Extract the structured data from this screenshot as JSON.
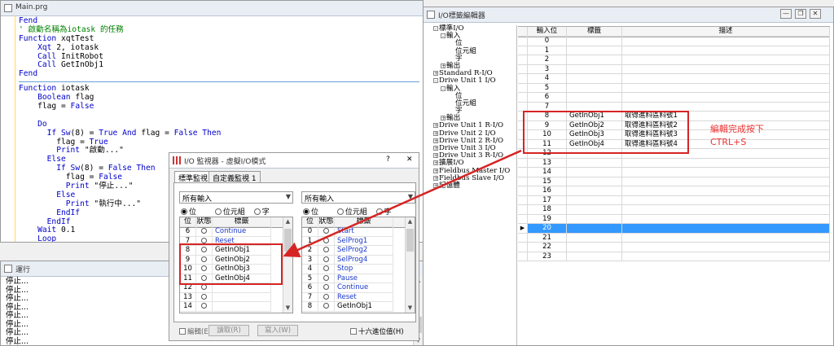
{
  "editor": {
    "title": "Main.prg",
    "lines": [
      [
        {
          "t": "Fend",
          "c": "kw"
        }
      ],
      [
        {
          "t": "' 啟動名稱為iotask 的任務",
          "c": "cm"
        }
      ],
      [
        {
          "t": "Function ",
          "c": "kw"
        },
        {
          "t": "xqtTest",
          "c": ""
        }
      ],
      [
        {
          "t": "    Xqt ",
          "c": "kw"
        },
        {
          "t": "2, iotask",
          "c": ""
        }
      ],
      [
        {
          "t": "    Call ",
          "c": "kw"
        },
        {
          "t": "InitRobot",
          "c": ""
        }
      ],
      [
        {
          "t": "    Call ",
          "c": "kw"
        },
        {
          "t": "GetInObj1",
          "c": ""
        }
      ],
      [
        {
          "t": "Fend",
          "c": "kw"
        }
      ],
      "SEP",
      [
        {
          "t": "Function ",
          "c": "kw"
        },
        {
          "t": "iotask",
          "c": ""
        }
      ],
      [
        {
          "t": "    Boolean ",
          "c": "kw"
        },
        {
          "t": "flag",
          "c": ""
        }
      ],
      [
        {
          "t": "    flag = ",
          "c": ""
        },
        {
          "t": "False",
          "c": "kw"
        }
      ],
      [
        {
          "t": "",
          "c": ""
        }
      ],
      [
        {
          "t": "    Do",
          "c": "kw"
        }
      ],
      [
        {
          "t": "      If ",
          "c": "kw"
        },
        {
          "t": "Sw",
          "c": "kw"
        },
        {
          "t": "(8) = ",
          "c": ""
        },
        {
          "t": "True ",
          "c": "kw"
        },
        {
          "t": "And ",
          "c": "kw"
        },
        {
          "t": "flag = ",
          "c": ""
        },
        {
          "t": "False ",
          "c": "kw"
        },
        {
          "t": "Then",
          "c": "kw"
        }
      ],
      [
        {
          "t": "        flag = ",
          "c": ""
        },
        {
          "t": "True",
          "c": "kw"
        }
      ],
      [
        {
          "t": "        Print ",
          "c": "kw"
        },
        {
          "t": "\"啟動...\"",
          "c": ""
        }
      ],
      [
        {
          "t": "      Else",
          "c": "kw"
        }
      ],
      [
        {
          "t": "        If ",
          "c": "kw"
        },
        {
          "t": "Sw",
          "c": "kw"
        },
        {
          "t": "(8) = ",
          "c": ""
        },
        {
          "t": "False ",
          "c": "kw"
        },
        {
          "t": "Then",
          "c": "kw"
        }
      ],
      [
        {
          "t": "          flag = ",
          "c": ""
        },
        {
          "t": "False",
          "c": "kw"
        }
      ],
      [
        {
          "t": "          Print ",
          "c": "kw"
        },
        {
          "t": "\"停止...\"",
          "c": ""
        }
      ],
      [
        {
          "t": "        Else",
          "c": "kw"
        }
      ],
      [
        {
          "t": "          Print ",
          "c": "kw"
        },
        {
          "t": "\"執行中...\"",
          "c": ""
        }
      ],
      [
        {
          "t": "        EndIf",
          "c": "kw"
        }
      ],
      [
        {
          "t": "      EndIf",
          "c": "kw"
        }
      ],
      [
        {
          "t": "    Wait ",
          "c": "kw"
        },
        {
          "t": "0.1",
          "c": ""
        }
      ],
      [
        {
          "t": "    Loop",
          "c": "kw"
        }
      ]
    ]
  },
  "output": {
    "title": "運行",
    "lines": [
      "停止...",
      "停止...",
      "停止...",
      "停止...",
      "停止...",
      "停止...",
      "停止...",
      "停止...",
      "停止...",
      "停止..."
    ]
  },
  "monitor": {
    "title": "I/O 監視器 - 虛擬I/O模式",
    "help": "?",
    "close": "✕",
    "tabs": [
      "標準監視",
      "自定義監視 1"
    ],
    "left": {
      "combo": "所有輸入",
      "radios": [
        "位",
        "位元組",
        "字"
      ],
      "headers": [
        "位",
        "狀態",
        "標籤"
      ],
      "rows": [
        {
          "n": "6",
          "l": "Continue",
          "b": true
        },
        {
          "n": "7",
          "l": "Reset",
          "b": true
        },
        {
          "n": "8",
          "l": "GetInObj1",
          "b": false
        },
        {
          "n": "9",
          "l": "GetInObj2",
          "b": false
        },
        {
          "n": "10",
          "l": "GetInObj3",
          "b": false
        },
        {
          "n": "11",
          "l": "GetInObj4",
          "b": false
        },
        {
          "n": "12",
          "l": "",
          "b": false
        },
        {
          "n": "13",
          "l": "",
          "b": false
        },
        {
          "n": "14",
          "l": "",
          "b": false
        }
      ]
    },
    "right": {
      "combo": "所有輸入",
      "radios": [
        "位",
        "位元組",
        "字"
      ],
      "headers": [
        "位",
        "狀態",
        "標籤"
      ],
      "rows": [
        {
          "n": "0",
          "l": "Start",
          "b": true
        },
        {
          "n": "1",
          "l": "SelProg1",
          "b": true
        },
        {
          "n": "2",
          "l": "SelProg2",
          "b": true
        },
        {
          "n": "3",
          "l": "SelProg4",
          "b": true
        },
        {
          "n": "4",
          "l": "Stop",
          "b": true
        },
        {
          "n": "5",
          "l": "Pause",
          "b": true
        },
        {
          "n": "6",
          "l": "Continue",
          "b": true
        },
        {
          "n": "7",
          "l": "Reset",
          "b": true
        },
        {
          "n": "8",
          "l": "GetInObj1",
          "b": false
        }
      ]
    },
    "edit_label": "編輯(E)",
    "read_button": "讀取(R)",
    "write_button": "寫入(W)",
    "hex_label": "十六進位值(H)"
  },
  "label_editor": {
    "title": "I/O標籤編輯器",
    "tree": [
      {
        "d": 0,
        "b": "-",
        "t": "標準I/O"
      },
      {
        "d": 1,
        "b": "-",
        "t": "輸入"
      },
      {
        "d": 3,
        "b": "",
        "t": "位"
      },
      {
        "d": 3,
        "b": "",
        "t": "位元組"
      },
      {
        "d": 3,
        "b": "",
        "t": "字"
      },
      {
        "d": 1,
        "b": "+",
        "t": "輸出"
      },
      {
        "d": 0,
        "b": "+",
        "t": "Standard R-I/O"
      },
      {
        "d": 0,
        "b": "-",
        "t": "Drive Unit 1 I/O"
      },
      {
        "d": 1,
        "b": "-",
        "t": "輸入"
      },
      {
        "d": 3,
        "b": "",
        "t": "位"
      },
      {
        "d": 3,
        "b": "",
        "t": "位元組"
      },
      {
        "d": 3,
        "b": "",
        "t": "字"
      },
      {
        "d": 1,
        "b": "+",
        "t": "輸出"
      },
      {
        "d": 0,
        "b": "+",
        "t": "Drive Unit 1 R-I/O"
      },
      {
        "d": 0,
        "b": "+",
        "t": "Drive Unit 2 I/O"
      },
      {
        "d": 0,
        "b": "+",
        "t": "Drive Unit 2 R-I/O"
      },
      {
        "d": 0,
        "b": "+",
        "t": "Drive Unit 3 I/O"
      },
      {
        "d": 0,
        "b": "+",
        "t": "Drive Unit 3 R-I/O"
      },
      {
        "d": 0,
        "b": "+",
        "t": "擴展I/O"
      },
      {
        "d": 0,
        "b": "+",
        "t": "Fieldbus Master I/O"
      },
      {
        "d": 0,
        "b": "+",
        "t": "Fieldbus Slave I/O"
      },
      {
        "d": 0,
        "b": "+",
        "t": "記憶體"
      }
    ],
    "headers": [
      "輸入位",
      "標籤",
      "描述"
    ],
    "rows": [
      {
        "n": "0",
        "l": "",
        "d": ""
      },
      {
        "n": "1",
        "l": "",
        "d": ""
      },
      {
        "n": "2",
        "l": "",
        "d": ""
      },
      {
        "n": "3",
        "l": "",
        "d": ""
      },
      {
        "n": "4",
        "l": "",
        "d": ""
      },
      {
        "n": "5",
        "l": "",
        "d": ""
      },
      {
        "n": "6",
        "l": "",
        "d": ""
      },
      {
        "n": "7",
        "l": "",
        "d": ""
      },
      {
        "n": "8",
        "l": "GetInObj1",
        "d": "取得進料區料號1"
      },
      {
        "n": "9",
        "l": "GetInObj2",
        "d": "取得進料區料號2"
      },
      {
        "n": "10",
        "l": "GetInObj3",
        "d": "取得進料區料號3"
      },
      {
        "n": "11",
        "l": "GetInObj4",
        "d": "取得進料區料號4"
      },
      {
        "n": "12",
        "l": "",
        "d": ""
      },
      {
        "n": "13",
        "l": "",
        "d": ""
      },
      {
        "n": "14",
        "l": "",
        "d": ""
      },
      {
        "n": "15",
        "l": "",
        "d": ""
      },
      {
        "n": "16",
        "l": "",
        "d": ""
      },
      {
        "n": "17",
        "l": "",
        "d": ""
      },
      {
        "n": "18",
        "l": "",
        "d": ""
      },
      {
        "n": "19",
        "l": "",
        "d": ""
      },
      {
        "n": "20",
        "l": "",
        "d": ""
      },
      {
        "n": "21",
        "l": "",
        "d": ""
      },
      {
        "n": "22",
        "l": "",
        "d": ""
      },
      {
        "n": "23",
        "l": "",
        "d": ""
      }
    ],
    "selected_row": "20"
  },
  "annotation": {
    "line1": "編輯完成按下",
    "line2": "CTRL+S",
    "color": "#d62424"
  }
}
